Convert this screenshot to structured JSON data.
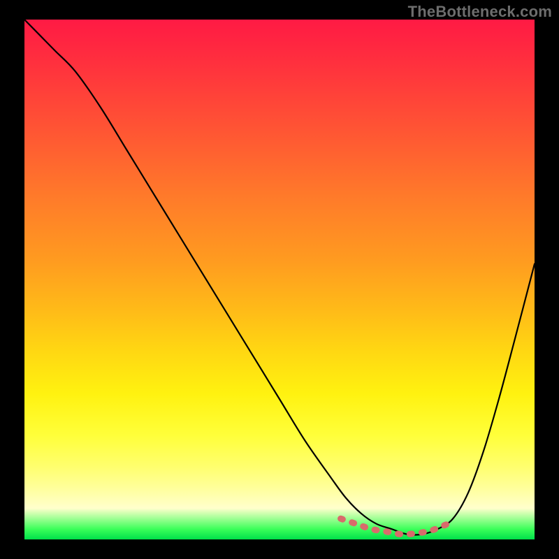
{
  "watermark": "TheBottleneck.com",
  "colors": {
    "background": "#000000",
    "curve_stroke": "#000000",
    "highlight_stroke": "#d86b6b",
    "gradient_top": "#ff1a44",
    "gradient_bottom": "#00e04a"
  },
  "chart_data": {
    "type": "line",
    "title": "",
    "xlabel": "",
    "ylabel": "",
    "xlim": [
      0,
      100
    ],
    "ylim": [
      0,
      100
    ],
    "grid": false,
    "legend": false,
    "series": [
      {
        "name": "bottleneck-curve",
        "x": [
          0,
          3,
          6,
          10,
          15,
          20,
          25,
          30,
          35,
          40,
          45,
          50,
          55,
          60,
          63,
          66,
          69,
          72,
          75,
          78,
          81,
          84,
          87,
          90,
          93,
          96,
          100
        ],
        "y": [
          100,
          97,
          94,
          90,
          83,
          75,
          67,
          59,
          51,
          43,
          35,
          27,
          19,
          12,
          8,
          5,
          3,
          2,
          1,
          1,
          2,
          4,
          9,
          17,
          27,
          38,
          53
        ]
      }
    ],
    "highlight": {
      "name": "optimal-range",
      "x": [
        62,
        65,
        68,
        71,
        74,
        77,
        80,
        83
      ],
      "y": [
        4,
        3,
        2,
        1.5,
        1,
        1.2,
        1.8,
        3
      ]
    }
  }
}
